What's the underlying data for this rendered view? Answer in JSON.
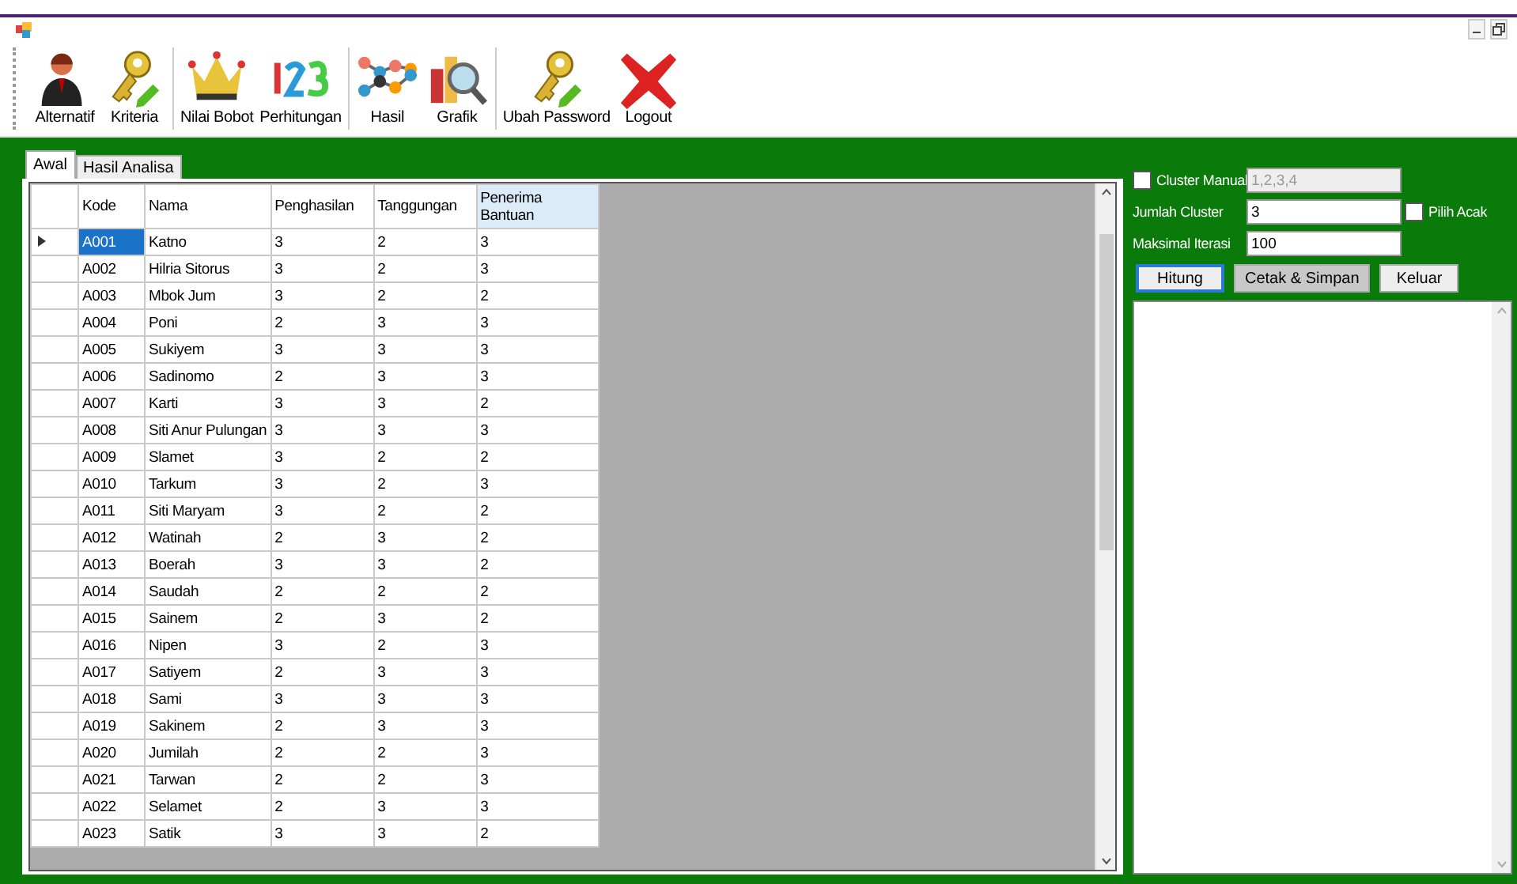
{
  "toolbar": {
    "groups": [
      [
        "Alternatif",
        "Kriteria"
      ],
      [
        "Nilai Bobot",
        "Perhitungan"
      ],
      [
        "Hasil",
        "Grafik"
      ],
      [
        "Ubah Password",
        "Logout"
      ]
    ]
  },
  "tabs": [
    {
      "label": "Awal",
      "selected": true
    },
    {
      "label": "Hasil Analisa",
      "selected": false
    }
  ],
  "table": {
    "columns": [
      {
        "label": "Kode",
        "selected": false
      },
      {
        "label": "Nama",
        "selected": false
      },
      {
        "label": "Penghasilan",
        "selected": false
      },
      {
        "label": "Tanggungan",
        "selected": false
      },
      {
        "label": "Penerima Bantuan",
        "selected": true
      }
    ],
    "rows": [
      {
        "selected": true,
        "cells": [
          "A001",
          "Katno",
          "3",
          "2",
          "3"
        ]
      },
      {
        "selected": false,
        "cells": [
          "A002",
          "Hilria Sitorus",
          "3",
          "2",
          "3"
        ]
      },
      {
        "selected": false,
        "cells": [
          "A003",
          "Mbok Jum",
          "3",
          "2",
          "2"
        ]
      },
      {
        "selected": false,
        "cells": [
          "A004",
          "Poni",
          "2",
          "3",
          "3"
        ]
      },
      {
        "selected": false,
        "cells": [
          "A005",
          "Sukiyem",
          "3",
          "3",
          "3"
        ]
      },
      {
        "selected": false,
        "cells": [
          "A006",
          "Sadinomo",
          "2",
          "3",
          "3"
        ]
      },
      {
        "selected": false,
        "cells": [
          "A007",
          "Karti",
          "3",
          "3",
          "2"
        ]
      },
      {
        "selected": false,
        "cells": [
          "A008",
          "Siti Anur Pulungan",
          "3",
          "3",
          "3"
        ]
      },
      {
        "selected": false,
        "cells": [
          "A009",
          "Slamet",
          "3",
          "2",
          "2"
        ]
      },
      {
        "selected": false,
        "cells": [
          "A010",
          "Tarkum",
          "3",
          "2",
          "3"
        ]
      },
      {
        "selected": false,
        "cells": [
          "A011",
          "Siti Maryam",
          "3",
          "2",
          "2"
        ]
      },
      {
        "selected": false,
        "cells": [
          "A012",
          "Watinah",
          "2",
          "3",
          "2"
        ]
      },
      {
        "selected": false,
        "cells": [
          "A013",
          "Boerah",
          "3",
          "3",
          "2"
        ]
      },
      {
        "selected": false,
        "cells": [
          "A014",
          "Saudah",
          "2",
          "2",
          "2"
        ]
      },
      {
        "selected": false,
        "cells": [
          "A015",
          "Sainem",
          "2",
          "3",
          "2"
        ]
      },
      {
        "selected": false,
        "cells": [
          "A016",
          "Nipen",
          "3",
          "2",
          "3"
        ]
      },
      {
        "selected": false,
        "cells": [
          "A017",
          "Satiyem",
          "2",
          "3",
          "3"
        ]
      },
      {
        "selected": false,
        "cells": [
          "A018",
          "Sami",
          "3",
          "3",
          "3"
        ]
      },
      {
        "selected": false,
        "cells": [
          "A019",
          "Sakinem",
          "2",
          "3",
          "3"
        ]
      },
      {
        "selected": false,
        "cells": [
          "A020",
          "Jumilah",
          "2",
          "2",
          "3"
        ]
      },
      {
        "selected": false,
        "cells": [
          "A021",
          "Tarwan",
          "2",
          "2",
          "3"
        ]
      },
      {
        "selected": false,
        "cells": [
          "A022",
          "Selamet",
          "2",
          "3",
          "3"
        ]
      },
      {
        "selected": false,
        "cells": [
          "A023",
          "Satik",
          "3",
          "3",
          "2"
        ]
      }
    ]
  },
  "settings": {
    "cluster_manual": {
      "label": "Cluster Manual",
      "checked": false,
      "value": "1,2,3,4",
      "disabled": true
    },
    "jumlah_cluster": {
      "label": "Jumlah Cluster",
      "value": "3"
    },
    "pilih_acak": {
      "label": "Pilih Acak",
      "checked": false
    },
    "maksimal_iterasi": {
      "label": "Maksimal Iterasi",
      "value": "100"
    }
  },
  "buttons": [
    {
      "label": "Hitung",
      "focused": true,
      "disabled": false
    },
    {
      "label": "Cetak & Simpan",
      "focused": false,
      "disabled": true
    },
    {
      "label": "Keluar",
      "focused": false,
      "disabled": false
    }
  ]
}
